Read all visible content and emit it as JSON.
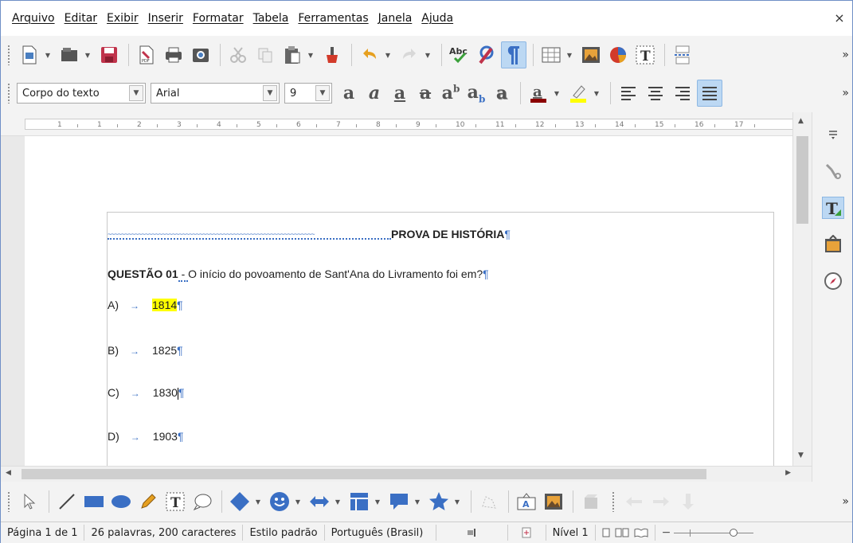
{
  "menu": {
    "items": [
      "Arquivo",
      "Editar",
      "Exibir",
      "Inserir",
      "Formatar",
      "Tabela",
      "Ferramentas",
      "Janela",
      "Ajuda"
    ],
    "close": "×"
  },
  "formatting": {
    "paragraph_style": "Corpo do texto",
    "font_name": "Arial",
    "font_size": "9",
    "spellcheck_label": "Abc"
  },
  "ruler": {
    "numbers": [
      "1",
      "1",
      "2",
      "3",
      "4",
      "5",
      "6",
      "7",
      "8",
      "9",
      "10",
      "11",
      "12",
      "13",
      "14",
      "15",
      "16",
      "17"
    ]
  },
  "document": {
    "title": "PROVA DE HISTÓRIA",
    "question_label": "QUESTÃO 01",
    "question_sep": " - ",
    "question_text": "O início do povoamento de Sant'Ana do Livramento foi em?",
    "pilcrow": "¶",
    "tab_arrow": "→",
    "options": [
      {
        "letter": "A)",
        "value": "1814",
        "highlight": true
      },
      {
        "letter": "B)",
        "value": "1825",
        "highlight": false
      },
      {
        "letter": "C)",
        "value": "1830",
        "highlight": false
      },
      {
        "letter": "D)",
        "value": "1903",
        "highlight": false
      }
    ]
  },
  "status": {
    "page": "Página 1 de 1",
    "words": "26 palavras, 200 caracteres",
    "style": "Estilo padrão",
    "language": "Português (Brasil)",
    "level": "Nível 1"
  },
  "colors": {
    "accent": "#3a6fc4",
    "highlight": "#ffff00",
    "pressed": "#bcd8f3"
  },
  "icons": {
    "toolbar1": [
      "new-document-icon",
      "open-icon",
      "save-icon",
      "export-pdf-icon",
      "print-icon",
      "print-preview-icon",
      "cut-icon",
      "copy-icon",
      "paste-icon",
      "clone-formatting-icon",
      "undo-icon",
      "redo-icon",
      "spellcheck-icon",
      "autocorrect-icon",
      "formatting-marks-icon",
      "table-icon",
      "image-icon",
      "chart-icon",
      "textbox-icon",
      "page-break-icon"
    ],
    "sidebar": [
      "sidebar-menu-icon",
      "properties-icon",
      "styles-icon",
      "gallery-icon",
      "navigator-icon"
    ]
  }
}
